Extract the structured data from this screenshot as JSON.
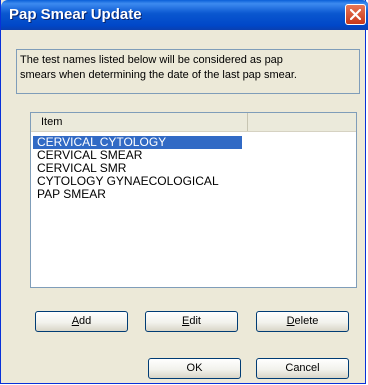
{
  "window": {
    "title": "Pap Smear Update"
  },
  "description": {
    "line1": "The test names listed below will be considered as pap",
    "line2": "smears when determining the date of the last pap smear."
  },
  "list": {
    "header": "Item",
    "items": [
      "CERVICAL CYTOLOGY",
      "CERVICAL SMEAR",
      "CERVICAL SMR",
      "CYTOLOGY GYNAECOLOGICAL",
      "PAP SMEAR"
    ],
    "selected_index": 0
  },
  "buttons": {
    "add": {
      "first": "A",
      "rest": "dd"
    },
    "edit": {
      "first": "E",
      "rest": "dit"
    },
    "delete": {
      "first": "D",
      "rest": "elete"
    },
    "ok": "OK",
    "cancel": "Cancel"
  },
  "icons": {
    "close": "close-icon"
  },
  "colors": {
    "titlebar": "#0047c8",
    "close_button": "#c8381a",
    "selection": "#316ac5",
    "dialog": "#ece9d8"
  }
}
